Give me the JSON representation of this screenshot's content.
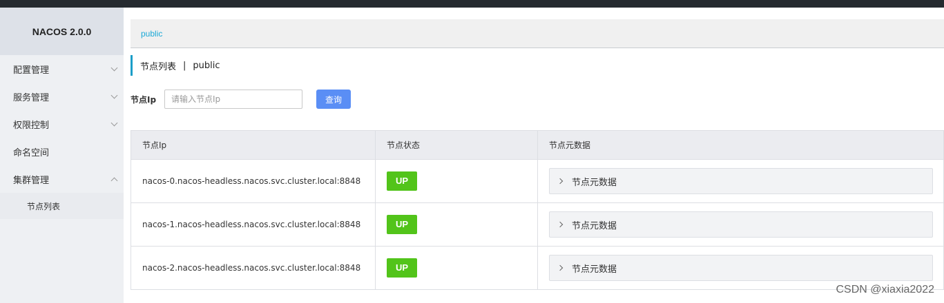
{
  "sidebar": {
    "logo": "NACOS 2.0.0",
    "items": [
      {
        "label": "配置管理",
        "expandable": true,
        "expanded": false
      },
      {
        "label": "服务管理",
        "expandable": true,
        "expanded": false
      },
      {
        "label": "权限控制",
        "expandable": true,
        "expanded": false
      },
      {
        "label": "命名空间",
        "expandable": false
      },
      {
        "label": "集群管理",
        "expandable": true,
        "expanded": true
      }
    ],
    "subitems": [
      {
        "label": "节点列表"
      }
    ]
  },
  "namespace_bar": {
    "current": "public"
  },
  "page": {
    "title": "节点列表",
    "separator": "|",
    "namespace": "public"
  },
  "filter": {
    "label": "节点Ip",
    "placeholder": "请输入节点Ip",
    "value": "",
    "button": "查询"
  },
  "table": {
    "headers": [
      "节点Ip",
      "节点状态",
      "节点元数据"
    ],
    "rows": [
      {
        "ip": "nacos-0.nacos-headless.nacos.svc.cluster.local:8848",
        "status": "UP",
        "metadata": "节点元数据"
      },
      {
        "ip": "nacos-1.nacos-headless.nacos.svc.cluster.local:8848",
        "status": "UP",
        "metadata": "节点元数据"
      },
      {
        "ip": "nacos-2.nacos-headless.nacos.svc.cluster.local:8848",
        "status": "UP",
        "metadata": "节点元数据"
      }
    ]
  },
  "watermark": "CSDN @xiaxia2022",
  "colors": {
    "accent": "#1b9ec8",
    "status_up": "#52c41a",
    "primary_button": "#5a8ef5",
    "namespace_link": "#1aa8d6"
  }
}
